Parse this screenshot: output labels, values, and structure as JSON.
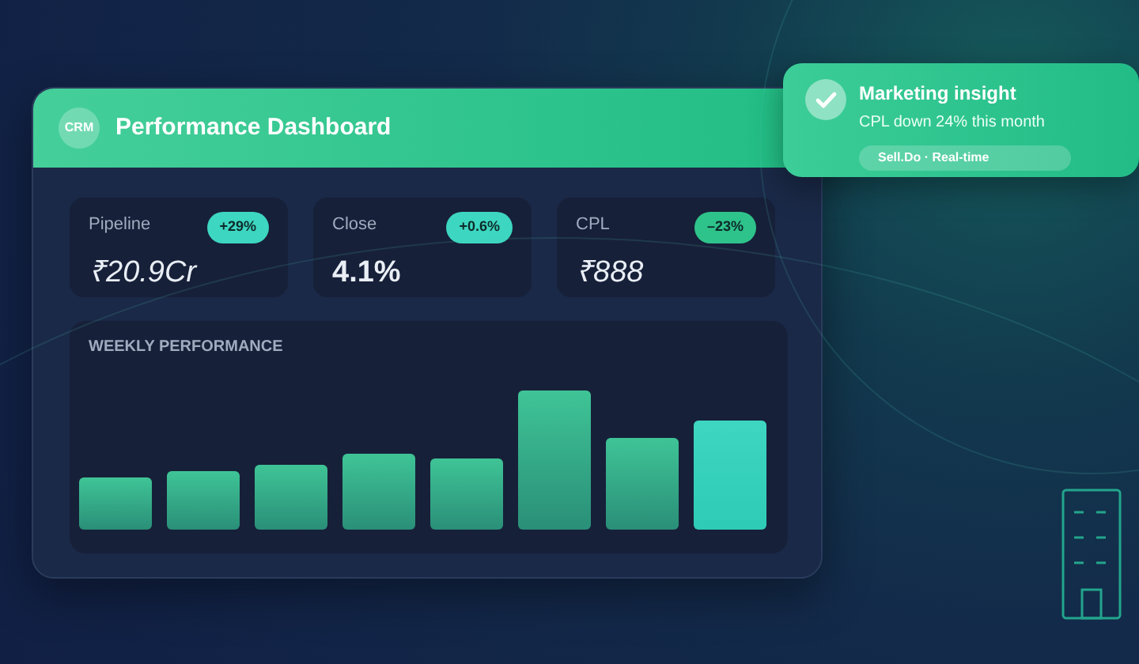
{
  "dashboard": {
    "logo": "CRM",
    "title": "Performance Dashboard"
  },
  "kpis": [
    {
      "label": "Pipeline",
      "value": "₹20.9Cr",
      "kind": "light",
      "badge": "+29%",
      "color": "#3dd6c0"
    },
    {
      "label": "Close",
      "value": "4.1%",
      "kind": "bold",
      "badge": "+0.6%",
      "color": "#3dd6c0"
    },
    {
      "label": "CPL",
      "value": "₹888",
      "kind": "light",
      "badge": "–23%",
      "color": "#2ec38a"
    }
  ],
  "chart": {
    "title": "WEEKLY PERFORMANCE"
  },
  "notification": {
    "title": "Marketing insight",
    "message": "CPL down 24% this month",
    "tag": "Sell.Do · Real-time"
  }
}
